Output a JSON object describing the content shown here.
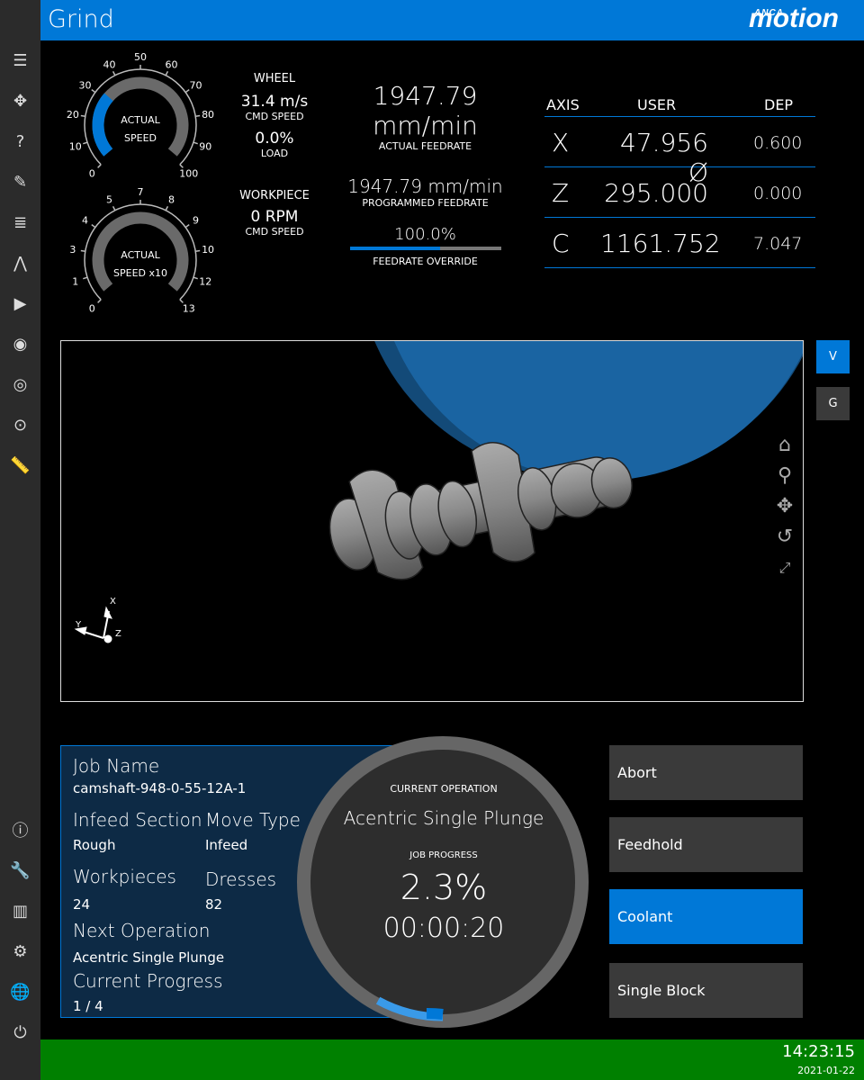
{
  "header": {
    "title": "Grind",
    "logo_small": "ANCA",
    "logo": "motion"
  },
  "sidebar": {
    "items": [
      "menu-icon",
      "move-icon",
      "help-question-icon",
      "pencil-icon",
      "list-icon",
      "compass-icon",
      "play-icon",
      "eye-icon",
      "disc-icon",
      "target-icon",
      "ruler-icon"
    ],
    "bottom_items": [
      "help-circle-icon",
      "wrench-icon",
      "tools-icon",
      "gear-icon",
      "globe-icon",
      "power-icon"
    ]
  },
  "wheel_gauge": {
    "label1": "ACTUAL",
    "label2": "SPEED",
    "min": 0,
    "max": 100,
    "value": 31.4,
    "ticks": [
      "0",
      "10",
      "20",
      "30",
      "40",
      "50",
      "60",
      "70",
      "80",
      "90",
      "100"
    ]
  },
  "work_gauge": {
    "label1": "ACTUAL",
    "label2": "SPEED x10",
    "value": 0,
    "ticks": [
      "0",
      "1",
      "3",
      "4",
      "5",
      "7",
      "8",
      "9",
      "10",
      "12",
      "13"
    ]
  },
  "wheel": {
    "title": "WHEEL",
    "cmd_speed": "31.4 m/s",
    "cmd_label": "CMD SPEED",
    "load": "0.0%",
    "load_label": "LOAD"
  },
  "workpiece": {
    "title": "WORKPIECE",
    "cmd_speed": "0 RPM",
    "cmd_label": "CMD SPEED"
  },
  "feed": {
    "actual": "1947.79 mm/min",
    "actual_label": "ACTUAL FEEDRATE",
    "programmed": "1947.79 mm/min",
    "programmed_label": "PROGRAMMED FEEDRATE",
    "override": "100.0%",
    "override_label": "FEEDRATE OVERRIDE",
    "override_fraction": 0.6
  },
  "axes": {
    "headers": [
      "AXIS",
      "USER",
      "DEP"
    ],
    "rows": [
      {
        "axis": "X",
        "user": "47.956 Ø",
        "dep": "0.600"
      },
      {
        "axis": "Z",
        "user": "295.000",
        "dep": "0.000"
      },
      {
        "axis": "C",
        "user": "1161.752",
        "dep": "7.047"
      }
    ]
  },
  "view": {
    "buttons": [
      "V",
      "G"
    ],
    "tools": [
      "home-icon",
      "zoom-icon",
      "pan-icon",
      "rotate-icon",
      "fit-icon"
    ],
    "triad": {
      "x": "X",
      "y": "Y",
      "z": "Z"
    }
  },
  "job": {
    "name_label": "Job Name",
    "name": "camshaft-948-0-55-12A-1",
    "infeed_label": "Infeed Section",
    "infeed": "Rough",
    "move_label": "Move Type",
    "move": "Infeed",
    "workpieces_label": "Workpieces",
    "workpieces": "24",
    "dresses_label": "Dresses",
    "dresses": "82",
    "next_label": "Next Operation",
    "next": "Acentric Single Plunge",
    "progress_label": "Current Progress",
    "progress": "1 / 4"
  },
  "operation": {
    "title": "CURRENT OPERATION",
    "name": "Acentric Single Plunge",
    "progress_label": "JOB PROGRESS",
    "progress": "2.3%",
    "time": "00:00:20"
  },
  "actions": [
    {
      "label": "Abort",
      "active": false
    },
    {
      "label": "Feedhold",
      "active": false
    },
    {
      "label": "Coolant",
      "active": true
    },
    {
      "label": "Single Block",
      "active": false
    }
  ],
  "footer": {
    "time": "14:23:15",
    "date": "2021-01-22"
  },
  "colors": {
    "accent": "#0078d7",
    "footer": "#008000",
    "sidebar": "#2b2b2b",
    "wheel": "#1a5f9a"
  }
}
